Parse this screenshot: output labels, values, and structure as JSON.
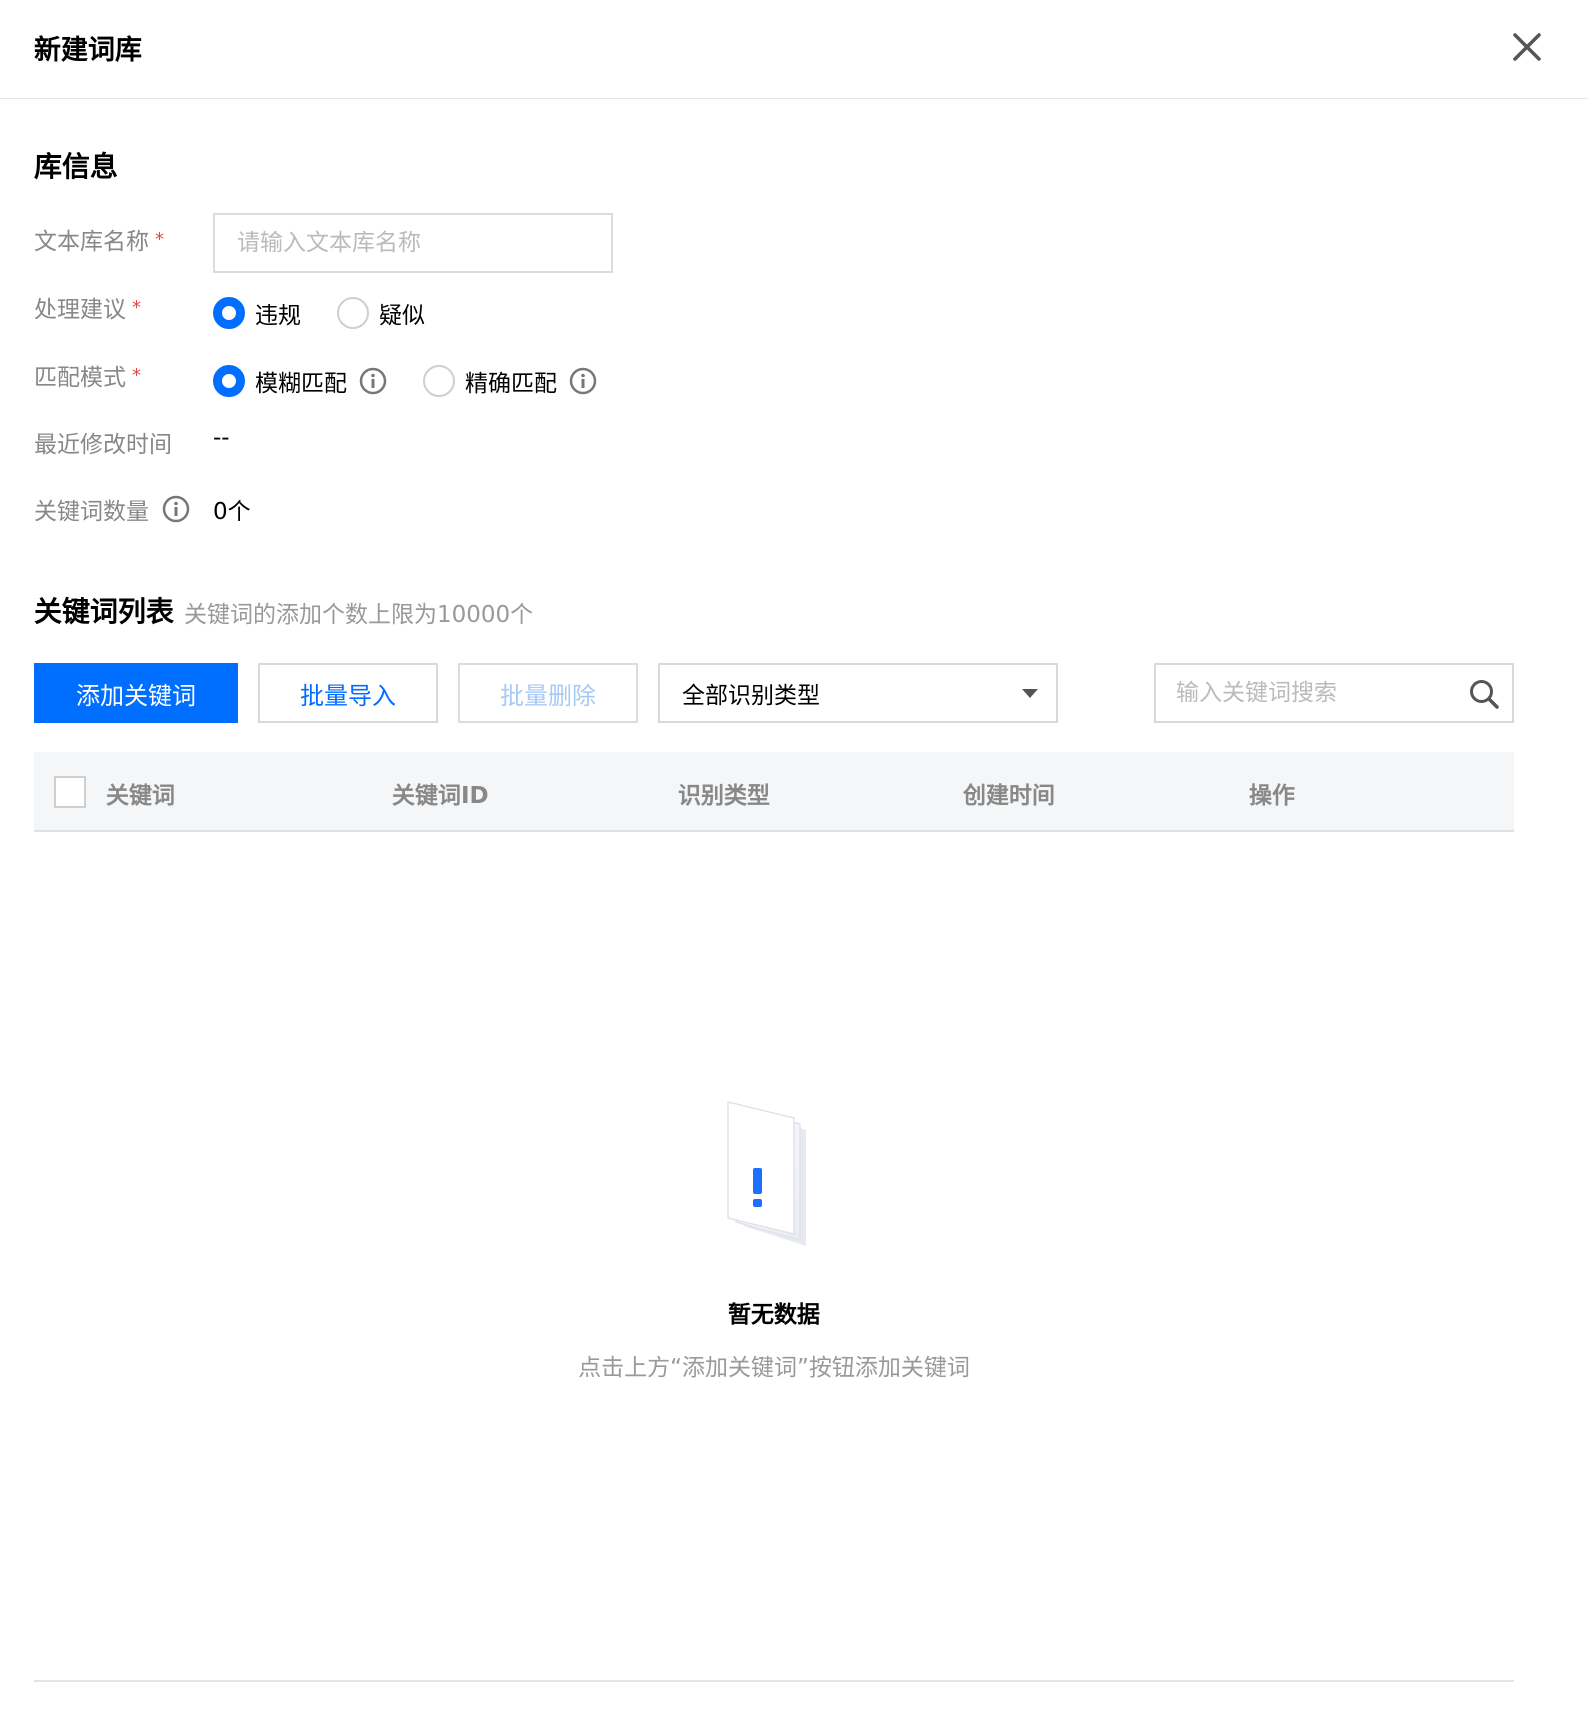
{
  "dialog": {
    "title": "新建词库"
  },
  "library_info": {
    "section_title": "库信息",
    "name_label": "文本库名称",
    "name_placeholder": "请输入文本库名称",
    "suggestion_label": "处理建议",
    "suggestion_options": [
      "违规",
      "疑似"
    ],
    "suggestion_selected": "违规",
    "match_label": "匹配模式",
    "match_options": [
      "模糊匹配",
      "精确匹配"
    ],
    "match_selected": "模糊匹配",
    "modified_label": "最近修改时间",
    "modified_value": "--",
    "count_label": "关键词数量",
    "count_value": "0个",
    "required_mark": "*"
  },
  "keyword_list": {
    "section_title": "关键词列表",
    "hint": "关键词的添加个数上限为10000个",
    "add_button": "添加关键词",
    "import_button": "批量导入",
    "delete_button": "批量删除",
    "type_filter": "全部识别类型",
    "search_placeholder": "输入关键词搜索",
    "columns": [
      "关键词",
      "关键词ID",
      "识别类型",
      "创建时间",
      "操作"
    ]
  },
  "empty_state": {
    "title": "暂无数据",
    "description": "点击上方“添加关键词”按钮添加关键词"
  },
  "colors": {
    "primary": "#006eff",
    "required": "#e54545",
    "label": "#888888"
  }
}
